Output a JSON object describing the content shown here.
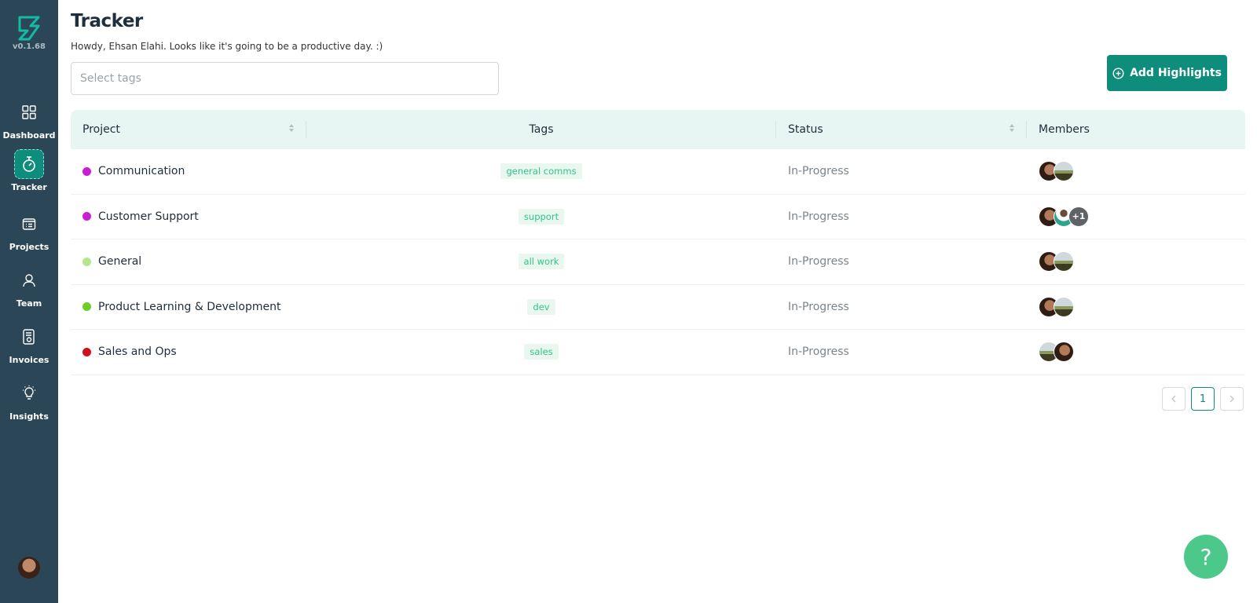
{
  "app": {
    "version": "v0.1.68"
  },
  "sidebar": {
    "items": [
      {
        "label": "Dashboard",
        "icon": "dashboard-icon"
      },
      {
        "label": "Tracker",
        "icon": "stopwatch-icon",
        "active": true
      },
      {
        "label": "Projects",
        "icon": "projects-icon"
      },
      {
        "label": "Team",
        "icon": "person-icon"
      },
      {
        "label": "Invoices",
        "icon": "invoice-icon"
      },
      {
        "label": "Insights",
        "icon": "lightbulb-icon"
      }
    ]
  },
  "header": {
    "title": "Tracker",
    "greeting": "Howdy, Ehsan Elahi. Looks like it's going to be a productive day. :)"
  },
  "filters": {
    "tags_placeholder": "Select tags"
  },
  "actions": {
    "add_highlights": "Add Highlights"
  },
  "table": {
    "columns": [
      "Project",
      "Tags",
      "Status",
      "Members"
    ],
    "rows": [
      {
        "project": "Communication",
        "color": "#c61fd4",
        "tag": "general comms",
        "status": "In-Progress",
        "members": [
          "a",
          "b"
        ],
        "extra": ""
      },
      {
        "project": "Customer Support",
        "color": "#c61fd4",
        "tag": "support",
        "status": "In-Progress",
        "members": [
          "a",
          "c"
        ],
        "extra": "+1"
      },
      {
        "project": "General",
        "color": "#b5e68c",
        "tag": "all work",
        "status": "In-Progress",
        "members": [
          "a",
          "b"
        ],
        "extra": ""
      },
      {
        "project": "Product Learning & Development",
        "color": "#6bcf2a",
        "tag": "dev",
        "status": "In-Progress",
        "members": [
          "a",
          "b"
        ],
        "extra": ""
      },
      {
        "project": "Sales and Ops",
        "color": "#d0101b",
        "tag": "sales",
        "status": "In-Progress",
        "members": [
          "b",
          "a"
        ],
        "extra": ""
      }
    ]
  },
  "pagination": {
    "current": "1"
  },
  "help": {
    "label": "?"
  },
  "colors": {
    "sidebar": "#2b4757",
    "accent": "#0e8c7c",
    "header_row": "#e8f6f3",
    "tag_text": "#31c48d",
    "help": "#4cc98a"
  }
}
